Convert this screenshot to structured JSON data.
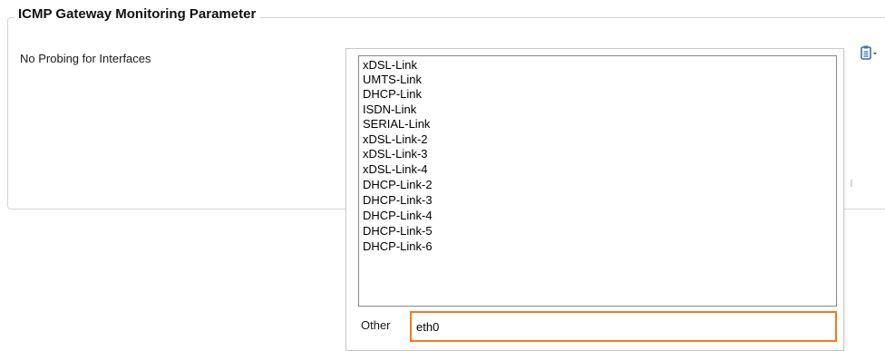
{
  "groupbox": {
    "title": "ICMP Gateway Monitoring Parameter"
  },
  "field": {
    "label": "No Probing for Interfaces"
  },
  "listbox": {
    "items": [
      "xDSL-Link",
      "UMTS-Link",
      "DHCP-Link",
      "ISDN-Link",
      "SERIAL-Link",
      "xDSL-Link-2",
      "xDSL-Link-3",
      "xDSL-Link-4",
      "DHCP-Link-2",
      "DHCP-Link-3",
      "DHCP-Link-4",
      "DHCP-Link-5",
      "DHCP-Link-6"
    ]
  },
  "other": {
    "label": "Other",
    "value": "eth0"
  },
  "colors": {
    "focus_border": "#f07c1e",
    "icon_blue": "#3d6fa6"
  },
  "icons": {
    "menu": "clipboard-menu-icon"
  }
}
